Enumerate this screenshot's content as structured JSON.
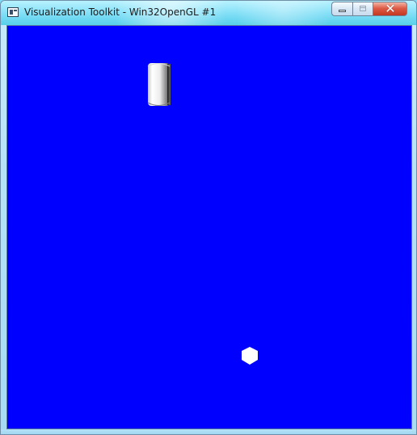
{
  "window": {
    "title": "Visualization Toolkit - Win32OpenGL #1",
    "icon": "vtk-window-icon",
    "controls": {
      "minimize_icon": "minimize-icon",
      "maximize_icon": "maximize-icon",
      "close_icon": "close-icon",
      "close_glyph": "✕"
    }
  },
  "render_view": {
    "background_color": "#0000ff",
    "objects": [
      {
        "name": "cylinder",
        "color": "#ffffff"
      },
      {
        "name": "hexagon",
        "color": "#ffffff"
      }
    ]
  }
}
